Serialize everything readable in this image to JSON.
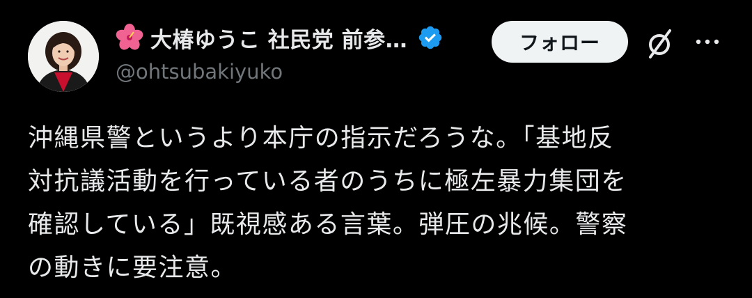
{
  "author": {
    "display_name": "大椿ゆうこ 社民党 前参…",
    "handle": "@ohtsubakiyuko",
    "name_emoji": "hibiscus-icon",
    "verified": true
  },
  "actions": {
    "follow_label": "フォロー",
    "grok_icon": "grok-icon",
    "more_icon": "more-icon"
  },
  "tweet": {
    "lines": [
      "沖縄県警というより本庁の指示だろうな。「基地反",
      "対抗議活動を行っている者のうちに極左暴力集団を",
      "確認している」既視感ある言葉。弾圧の兆候。警察",
      "の動きに要注意。"
    ]
  },
  "colors": {
    "background": "#000000",
    "text": "#e7e9ea",
    "secondary_text": "#71767b",
    "verified_blue": "#1d9bf0",
    "follow_bg": "#eff3f4"
  }
}
